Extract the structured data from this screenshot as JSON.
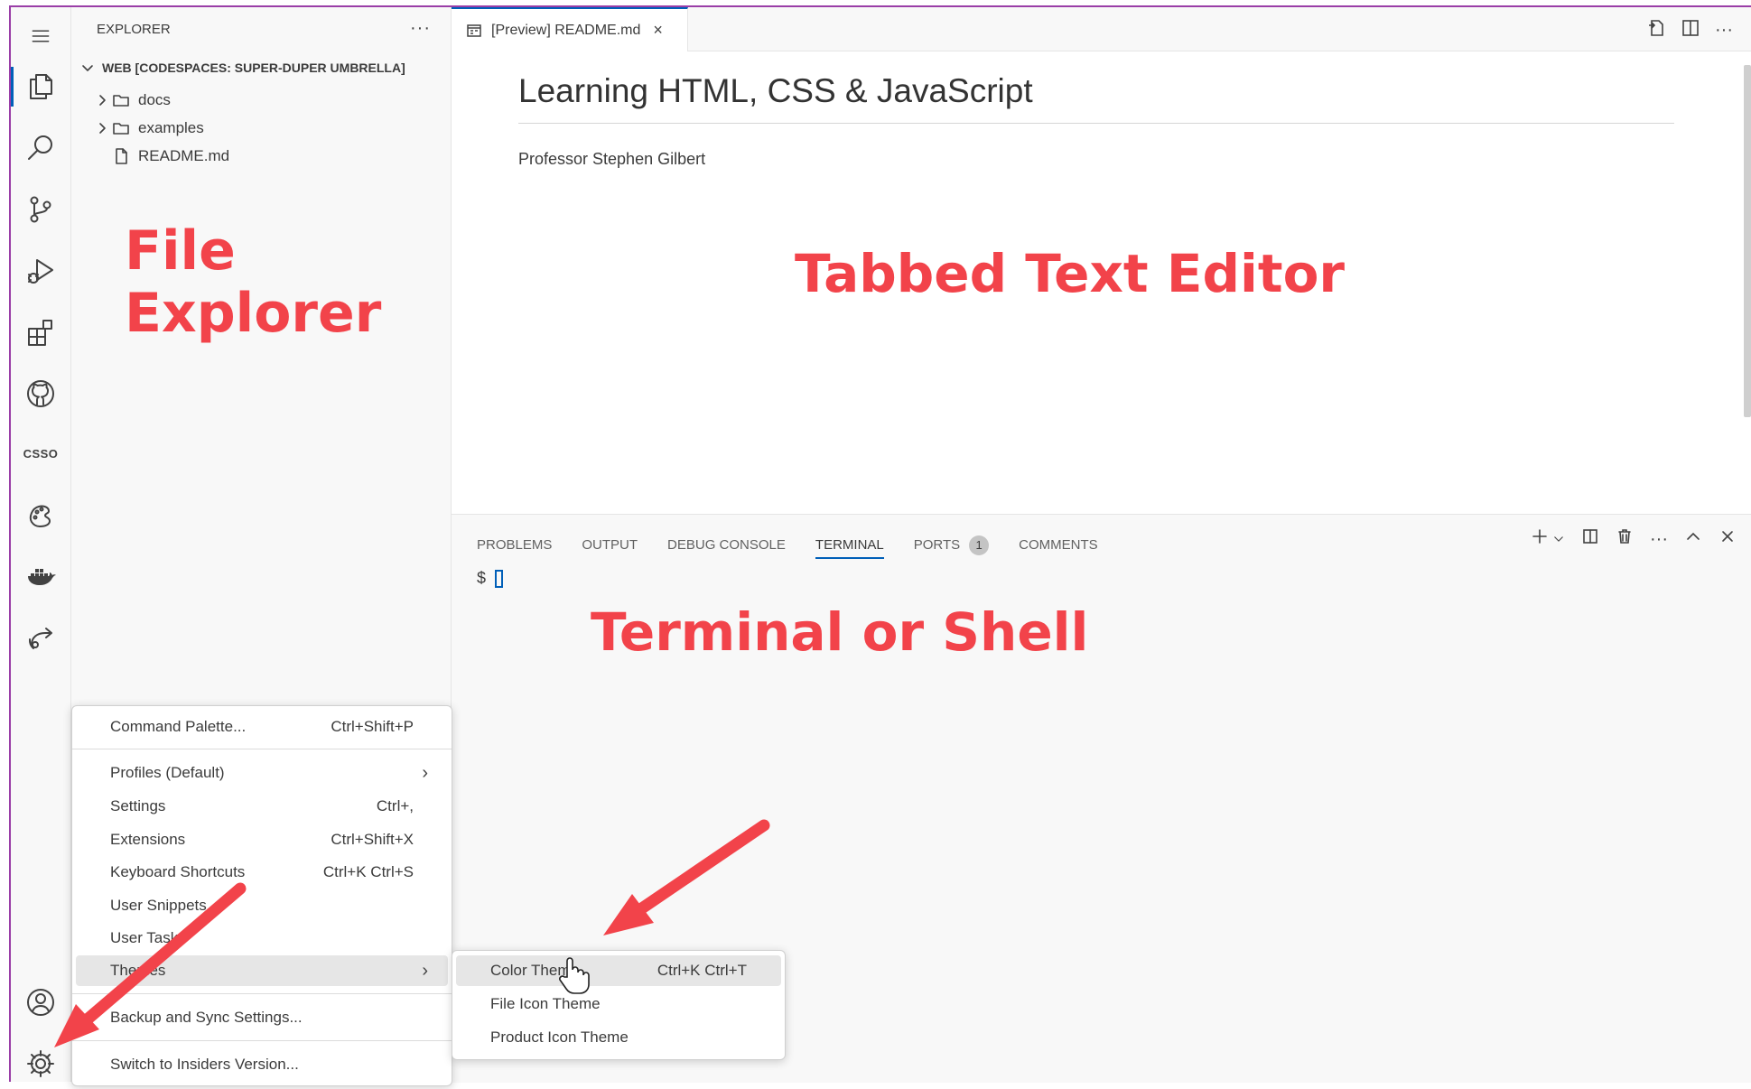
{
  "sidebar": {
    "title": "EXPLORER",
    "more": "···",
    "workspace": "WEB [CODESPACES: SUPER-DUPER UMBRELLA]",
    "items": [
      {
        "label": "docs",
        "type": "folder"
      },
      {
        "label": "examples",
        "type": "folder"
      },
      {
        "label": "README.md",
        "type": "file"
      }
    ]
  },
  "activity": {
    "csso_label": "CSSO"
  },
  "annotations": {
    "explorer_line1": "File",
    "explorer_line2": "Explorer",
    "editor": "Tabbed Text Editor",
    "terminal": "Terminal or Shell"
  },
  "editor": {
    "tab_label": "[Preview] README.md",
    "tab_close": "×",
    "heading": "Learning HTML, CSS & JavaScript",
    "paragraph": "Professor Stephen Gilbert"
  },
  "panel": {
    "tabs": [
      "PROBLEMS",
      "OUTPUT",
      "DEBUG CONSOLE",
      "TERMINAL",
      "PORTS",
      "COMMENTS"
    ],
    "ports_badge": "1",
    "prompt": "$",
    "more": "···"
  },
  "manage_menu": {
    "items": [
      {
        "label": "Command Palette...",
        "shortcut": "Ctrl+Shift+P"
      },
      {
        "label": "Profiles (Default)",
        "shortcut": ""
      },
      {
        "label": "Settings",
        "shortcut": "Ctrl+,"
      },
      {
        "label": "Extensions",
        "shortcut": "Ctrl+Shift+X"
      },
      {
        "label": "Keyboard Shortcuts",
        "shortcut": "Ctrl+K Ctrl+S"
      },
      {
        "label": "User Snippets",
        "shortcut": ""
      },
      {
        "label": "User Tasks",
        "shortcut": ""
      },
      {
        "label": "Themes",
        "shortcut": ""
      },
      {
        "label": "Backup and Sync Settings...",
        "shortcut": ""
      },
      {
        "label": "Switch to Insiders Version...",
        "shortcut": ""
      }
    ]
  },
  "themes_menu": {
    "items": [
      {
        "label": "Color Theme",
        "shortcut": "Ctrl+K Ctrl+T"
      },
      {
        "label": "File Icon Theme",
        "shortcut": ""
      },
      {
        "label": "Product Icon Theme",
        "shortcut": ""
      }
    ]
  },
  "colors": {
    "accent": "#005fb8",
    "annotation": "#f2434a",
    "frame": "#9a3ea7"
  }
}
